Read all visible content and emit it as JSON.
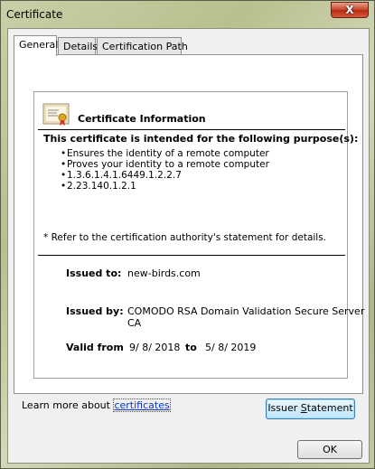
{
  "window": {
    "title": "Certificate",
    "close_glyph": "X"
  },
  "tabs": [
    {
      "label": "General",
      "active": true
    },
    {
      "label": "Details",
      "active": false
    },
    {
      "label": "Certification Path",
      "active": false
    }
  ],
  "info": {
    "heading": "Certificate Information",
    "purpose_heading": "This certificate is intended for the following purpose(s):",
    "purposes": [
      "Ensures the identity of a remote computer",
      "Proves your identity to a remote computer",
      "1.3.6.1.4.1.6449.1.2.2.7",
      "2.23.140.1.2.1"
    ],
    "refer_note": "* Refer to the certification authority's statement for details.",
    "issued_to_label": "Issued to:",
    "issued_to_value": "new-birds.com",
    "issued_by_label": "Issued by:",
    "issued_by_value_line1": "COMODO RSA Domain Validation Secure Server",
    "issued_by_value_line2": "CA",
    "valid_from_label": "Valid from",
    "valid_from_value": "9/ 8/ 2018",
    "valid_to_label": "to",
    "valid_to_value": "5/ 8/ 2019"
  },
  "buttons": {
    "issuer_statement_prefix": "Issuer ",
    "issuer_statement_accel": "S",
    "issuer_statement_suffix": "tatement",
    "ok": "OK"
  },
  "learn_more": {
    "prefix": "Learn more about ",
    "link": "certificates"
  },
  "colors": {
    "link": "#0b36c5",
    "window_frame": "#c9cfa8"
  },
  "icons": {
    "certificate": "certificate-icon",
    "close": "close-icon"
  }
}
